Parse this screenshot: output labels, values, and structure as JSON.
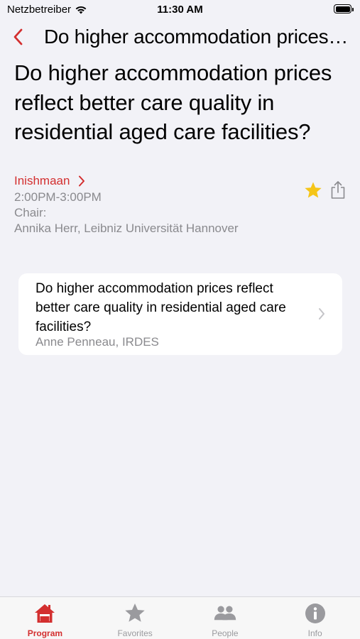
{
  "status_bar": {
    "carrier": "Netzbetreiber",
    "time": "11:30 AM"
  },
  "nav": {
    "title": "Do higher accommodation prices reflect better care quality in residential aged care facilities?"
  },
  "session": {
    "title": "Do higher accommodation prices reflect better care quality in residential aged care facilities?",
    "room": "Inishmaan",
    "time": "2:00PM-3:00PM",
    "chair_label": "Chair:",
    "chair_name": "Annika Herr, Leibniz Universität Hannover",
    "favorite": true
  },
  "presentations": [
    {
      "title": "Do higher accommodation prices reflect better care quality in residential aged care facilities?",
      "presenter": "Anne Penneau, IRDES"
    }
  ],
  "tabs": [
    {
      "label": "Program",
      "icon": "home-icon",
      "active": true
    },
    {
      "label": "Favorites",
      "icon": "star-icon",
      "active": false
    },
    {
      "label": "People",
      "icon": "people-icon",
      "active": false
    },
    {
      "label": "Info",
      "icon": "info-icon",
      "active": false
    }
  ],
  "colors": {
    "accent": "#d32f2f",
    "star": "#f5c518",
    "secondary_text": "#8a8a8e",
    "background": "#f2f2f7"
  }
}
